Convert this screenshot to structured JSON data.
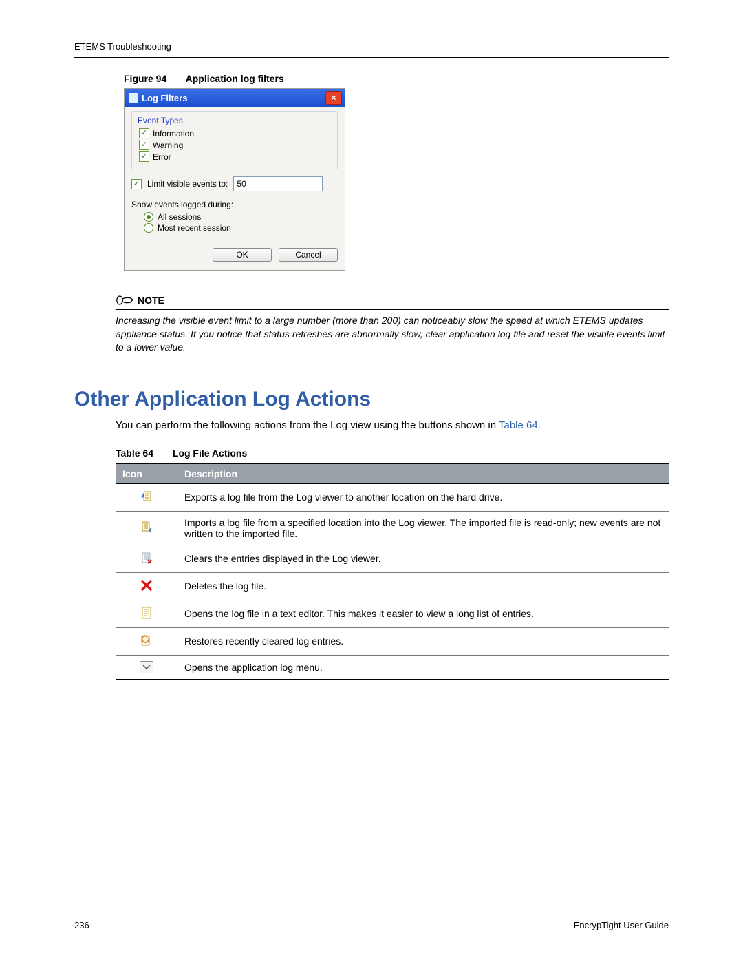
{
  "header": {
    "breadcrumb": "ETEMS Troubleshooting"
  },
  "figure": {
    "label": "Figure 94",
    "title": "Application log filters"
  },
  "dialog": {
    "title": "Log Filters",
    "group_title": "Event Types",
    "chk_information": "Information",
    "chk_warning": "Warning",
    "chk_error": "Error",
    "limit_label": "Limit visible events to:",
    "limit_value": "50",
    "show_label": "Show events logged during:",
    "radio_all": "All sessions",
    "radio_recent": "Most recent session",
    "ok": "OK",
    "cancel": "Cancel"
  },
  "note": {
    "heading": "NOTE",
    "text": "Increasing the visible event limit to a large number (more than 200) can noticeably slow the speed at which ETEMS updates appliance status. If you notice that status refreshes are abnormally slow, clear application log file and reset the visible events limit to a lower value."
  },
  "section": {
    "title": "Other Application Log Actions"
  },
  "body": {
    "text_prefix": "You can perform the following actions from the Log view using the buttons shown in ",
    "link_text": "Table 64",
    "text_suffix": "."
  },
  "table": {
    "label": "Table 64",
    "title": "Log File Actions",
    "headers": {
      "icon": "Icon",
      "desc": "Description"
    },
    "rows": [
      {
        "desc": "Exports a log file from the Log viewer to another location on the hard drive."
      },
      {
        "desc": "Imports a log file from a specified location into the Log viewer. The imported file is read-only; new events are not written to the imported file."
      },
      {
        "desc": "Clears the entries displayed in the Log viewer."
      },
      {
        "desc": "Deletes the log file."
      },
      {
        "desc": "Opens the log file in a text editor. This makes it easier to view a long list of entries."
      },
      {
        "desc": "Restores recently cleared log entries."
      },
      {
        "desc": "Opens the application log menu."
      }
    ]
  },
  "footer": {
    "page": "236",
    "doc": "EncrypTight User Guide"
  }
}
